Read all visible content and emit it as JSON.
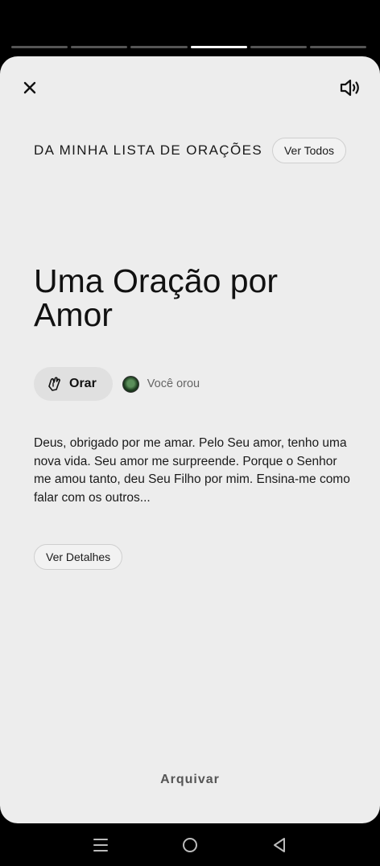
{
  "progress": {
    "segments": 6,
    "active_index": 3
  },
  "header": {
    "close_icon": "close-icon",
    "sound_icon": "speaker-icon",
    "list_title": "DA MINHA LISTA DE ORAÇÕES",
    "see_all_label": "Ver Todos"
  },
  "prayer": {
    "title": "Uma Oração por Amor",
    "pray_label": "Orar",
    "pray_icon": "praying-hands-icon",
    "prayed_status": "Você orou",
    "body": "Deus, obrigado por me amar. Pelo Seu amor, tenho uma nova vida. Seu amor me surpreende. Porque o Senhor me amou tanto, deu Seu Filho por mim. Ensina-me como falar com os outros...",
    "details_label": "Ver Detalhes"
  },
  "footer": {
    "archive_label": "Arquivar"
  },
  "system_nav": [
    "menu-icon",
    "home-icon",
    "back-icon"
  ]
}
